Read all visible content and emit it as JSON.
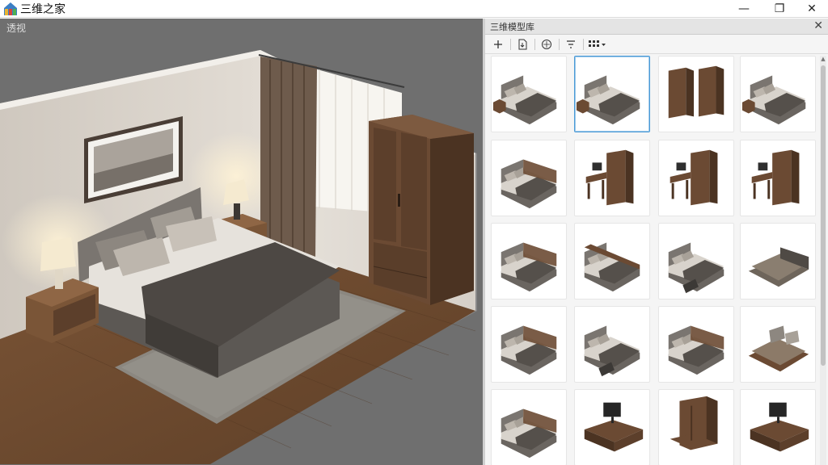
{
  "app": {
    "title": "三维之家"
  },
  "window_controls": {
    "minimize": "—",
    "maximize": "❐",
    "close": "✕"
  },
  "viewport": {
    "label": "透视"
  },
  "library": {
    "title": "三维模型库",
    "close": "✕",
    "toolbar": [
      "add",
      "import",
      "material",
      "filter",
      "view-grid"
    ],
    "items": [
      {
        "kind": "bed-a",
        "selected": false
      },
      {
        "kind": "bed-a",
        "selected": true
      },
      {
        "kind": "wardrobe-pair",
        "selected": false
      },
      {
        "kind": "bed-a",
        "selected": false
      },
      {
        "kind": "bed-b",
        "selected": false
      },
      {
        "kind": "desk-wardrobe",
        "selected": false
      },
      {
        "kind": "desk-wardrobe",
        "selected": false
      },
      {
        "kind": "desk-wardrobe",
        "selected": false
      },
      {
        "kind": "bed-b",
        "selected": false
      },
      {
        "kind": "bed-c",
        "selected": false
      },
      {
        "kind": "bed-d",
        "selected": false
      },
      {
        "kind": "sofa-bed",
        "selected": false
      },
      {
        "kind": "bed-b",
        "selected": false
      },
      {
        "kind": "bed-d",
        "selected": false
      },
      {
        "kind": "bed-b",
        "selected": false
      },
      {
        "kind": "bed-e",
        "selected": false
      },
      {
        "kind": "bed-b",
        "selected": false
      },
      {
        "kind": "tv-desk",
        "selected": false
      },
      {
        "kind": "wardrobe-single",
        "selected": false
      },
      {
        "kind": "tv-desk",
        "selected": false
      }
    ]
  },
  "colors": {
    "wood": "#6b4a33",
    "wood_dark": "#4b3322",
    "fabric": "#6a6560",
    "linen": "#d8d3cc",
    "accent": "#4a9ad6"
  }
}
